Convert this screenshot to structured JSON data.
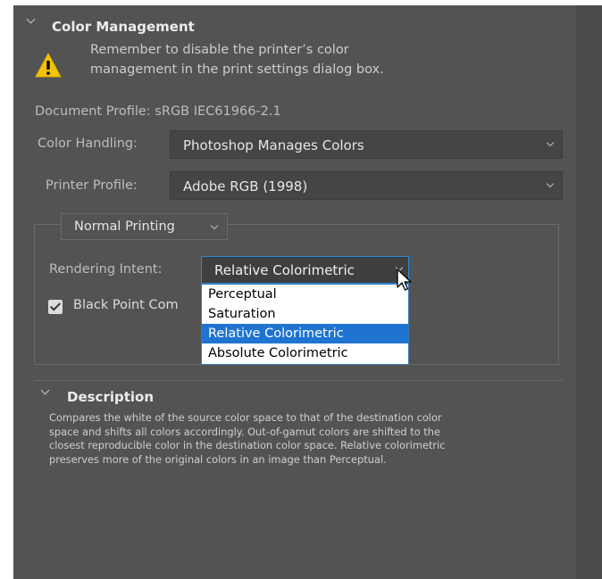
{
  "color_management": {
    "title": "Color Management",
    "warning_line1": "Remember to disable the printer’s color",
    "warning_line2": "management in the print settings dialog box.",
    "document_profile": "Document Profile: sRGB IEC61966-2.1",
    "color_handling_label": "Color Handling:",
    "color_handling_value": "Photoshop Manages Colors",
    "printer_profile_label": "Printer Profile:",
    "printer_profile_value": "Adobe RGB (1998)",
    "printing_mode_value": "Normal Printing",
    "rendering_intent_label": "Rendering Intent:",
    "rendering_intent_value": "Relative Colorimetric",
    "rendering_intent_options": [
      "Perceptual",
      "Saturation",
      "Relative Colorimetric",
      "Absolute Colorimetric"
    ],
    "rendering_intent_highlighted": "Relative Colorimetric",
    "black_point_label": "Black Point Com",
    "black_point_checked": true
  },
  "description": {
    "title": "Description",
    "lines": [
      "Compares the white of the source color space to that of the destination color",
      "space and shifts all colors accordingly. Out-of-gamut colors are shifted to the",
      "closest reproducible color in the destination color space. Relative colorimetric",
      "preserves more of the original colors in an image than Perceptual."
    ]
  },
  "colors": {
    "panel_bg": "#535353",
    "accent": "#1e74d0",
    "warning": "#f5c400"
  }
}
